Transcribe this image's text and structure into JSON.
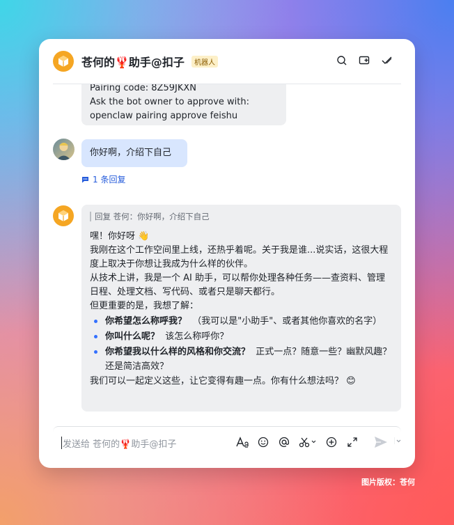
{
  "header": {
    "title": "苍何的🦞助手@扣子",
    "tag": "机器人",
    "icons": [
      "search-icon",
      "add-to-chat-icon",
      "done-icon"
    ]
  },
  "messages": {
    "pairing": {
      "line1": "Pairing code: 8Z59JKXN",
      "line2": "Ask the bot owner to approve with:",
      "line3": "openclaw pairing approve feishu"
    },
    "user": {
      "text": "你好啊，介绍下自己",
      "reply_count": "1 条回复"
    },
    "bot": {
      "quote": "回复 苍何：你好啊，介绍下自己",
      "p1": "嘿！你好呀 👋",
      "p2": "我刚在这个工作空间里上线，还热乎着呢。关于我是谁...说实话，这很大程度上取决于你想让我成为什么样的伙伴。",
      "p3": "从技术上讲，我是一个 AI 助手，可以帮你处理各种任务——查资料、管理日程、处理文档、写代码、或者只是聊天都行。",
      "p4": "但更重要的是，我想了解：",
      "items": [
        {
          "bold": "你希望怎么称呼我？",
          "rest": "（我可以是\"小助手\"、或者其他你喜欢的名字）"
        },
        {
          "bold": "你叫什么呢？",
          "rest": "该怎么称呼你？"
        },
        {
          "bold": "你希望我以什么样的风格和你交流？",
          "rest": "正式一点？随意一些？幽默风趣？还是简洁高效？"
        }
      ],
      "p5": "我们可以一起定义这些，让它变得有趣一点。你有什么想法吗？ 😊"
    }
  },
  "input": {
    "placeholder": "发送给 苍何的🦞助手@扣子",
    "tools": [
      "text-format-icon",
      "emoji-icon",
      "mention-icon",
      "screenshot-icon",
      "add-icon",
      "expand-icon",
      "send-icon"
    ]
  },
  "copyright": "图片版权：苍何",
  "colors": {
    "accent": "#3370ff",
    "bot_avatar": "#f5a623",
    "user_bubble": "#d8e6fe",
    "bot_bubble": "#eeeff1"
  }
}
